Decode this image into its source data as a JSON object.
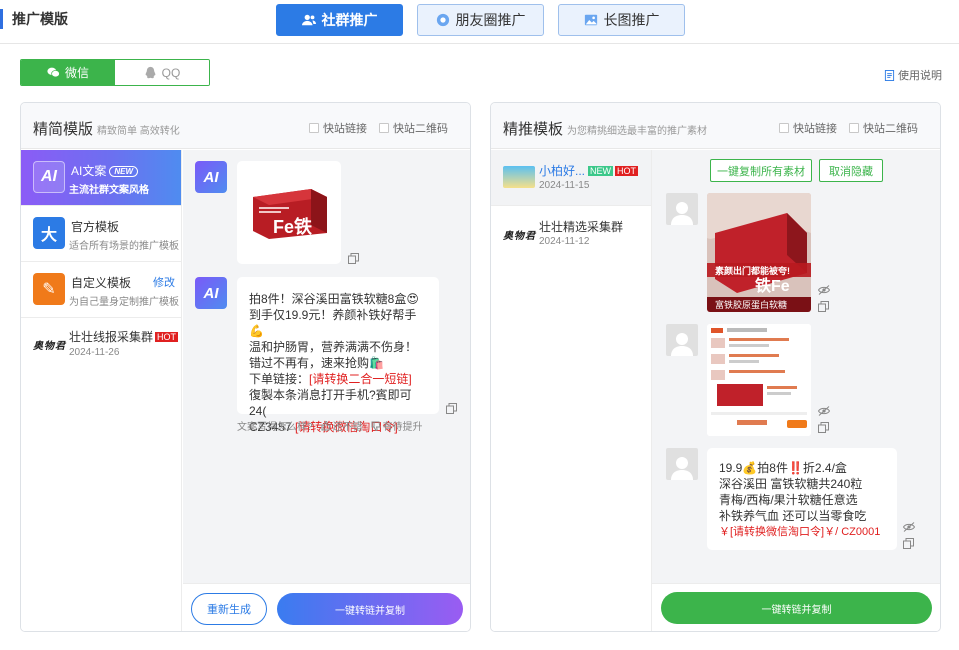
{
  "page_title": "推广模版",
  "tabs": [
    {
      "label": "社群推广",
      "active": true
    },
    {
      "label": "朋友圈推广",
      "active": false
    },
    {
      "label": "长图推广",
      "active": false
    }
  ],
  "platform_toggle": {
    "wechat": "微信",
    "qq": "QQ"
  },
  "help_link": "使用说明",
  "left_panel": {
    "title": "精简模版",
    "subtitle": "精致简单 高效转化",
    "check_link": "快站链接",
    "check_qr": "快站二维码",
    "templates": [
      {
        "icon": "AI",
        "name": "AI文案",
        "badge": "NEW",
        "desc": "主流社群文案风格"
      },
      {
        "icon": "大",
        "name": "官方模板",
        "desc": "适合所有场景的推广模板"
      },
      {
        "icon": "✎",
        "name": "自定义模板",
        "edit": "修改",
        "desc": "为自己量身定制推广模板"
      },
      {
        "logo": "奥物君",
        "name": "壮壮线报采集群",
        "badge": "HOT",
        "date": "2024-11-26"
      }
    ],
    "chat": {
      "avatar": "AI",
      "product_label": "Fe铁",
      "lines": [
        "拍8件！深谷溪田富铁软糖8盒😍",
        "到手仅19.9元！养颜补铁好帮手💪",
        "温和护肠胃，营养满满不伤身！",
        "错过不再有，速来抢购🛍️",
        "下单链接："
      ],
      "link_placeholder": "[请转换二合一短链]",
      "line_copy": "復製本条消息打开手机?賓即可24(",
      "code": "CZ3457 ",
      "code_placeholder": "[请转换微信淘口令]",
      "feedback_q": "文案写得怎么样?",
      "feedback_good": "还不错",
      "feedback_bad": "有待提升"
    },
    "btn_regen": "重新生成",
    "btn_convert": "一键转链并复制"
  },
  "right_panel": {
    "title": "精推模板",
    "subtitle": "为您精挑细选最丰富的推广素材",
    "check_link": "快站链接",
    "check_qr": "快站二维码",
    "groups": [
      {
        "name": "小柏好...",
        "badges": [
          "NEW",
          "HOT"
        ],
        "date": "2024-11-15"
      },
      {
        "logo": "奥物君",
        "name": "壮壮精选采集群",
        "date": "2024-11-12"
      }
    ],
    "btn_copy_all": "一键复制所有素材",
    "btn_hide": "取消隐藏",
    "img1_text_top": "素颜出门都能被夸!",
    "img1_text_fe": "铁Fe",
    "img1_text_bottom": "富铁胶原蛋白软糖",
    "msg_lines": [
      "19.9💰拍8件‼️折2.4/盒",
      "深谷溪田 富铁软糖共240粒",
      "青梅/西梅/果汁软糖任意选",
      "补铁养气血 还可以当零食吃"
    ],
    "msg_red": "￥[请转换微信淘口令]￥/ CZ0001",
    "btn_convert": "一键转链并复制"
  },
  "colors": {
    "primary": "#2c7be5",
    "green": "#3cb44b",
    "hot": "#e02020"
  }
}
